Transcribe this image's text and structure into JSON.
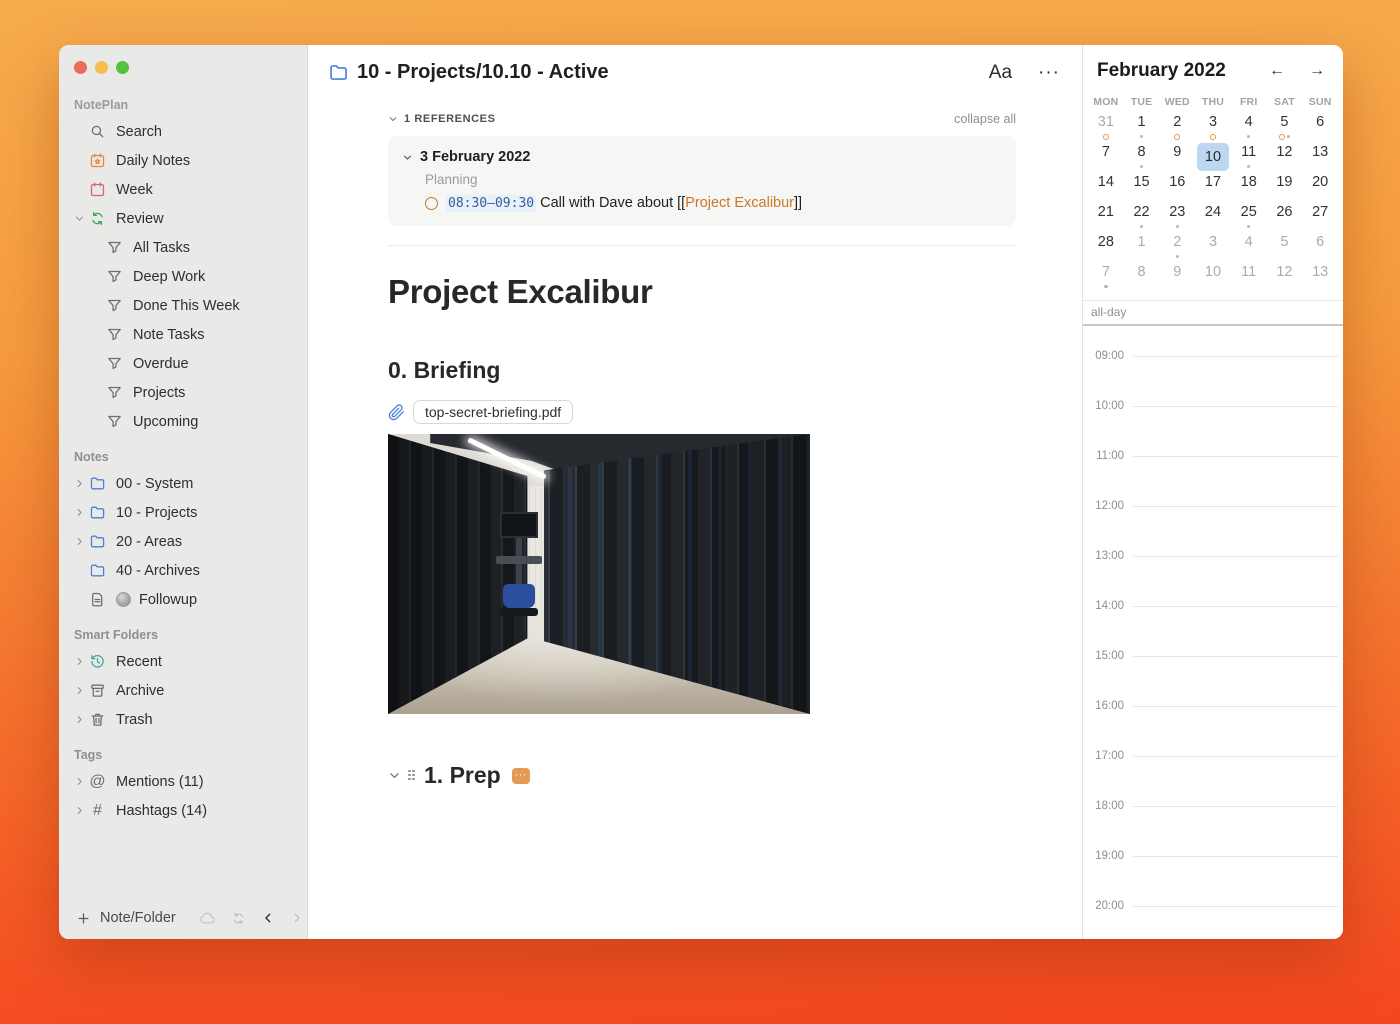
{
  "colors": {
    "background_top": "#F7AC4D",
    "background_bottom": "#F4461F",
    "accent_orange_link": "#CE7728",
    "timeblock_text": "#3A5C99",
    "timeblock_bg": "#E7F0FB",
    "selected_day_bg": "#BBD7F2",
    "event_ring": "#DFA13E",
    "task_dot": "#B9B9B9",
    "prep_badge_bg": "#E29A55"
  },
  "sidebar": {
    "app_name": "NotePlan",
    "top_items": [
      {
        "id": "search",
        "label": "Search",
        "icon": "search-icon",
        "color": "#6E6E6E",
        "chevron": "none"
      },
      {
        "id": "daily-notes",
        "label": "Daily Notes",
        "icon": "calendar-star-icon",
        "color": "#E8873A",
        "chevron": "none"
      },
      {
        "id": "week",
        "label": "Week",
        "icon": "calendar-icon",
        "color": "#E25C6A",
        "chevron": "none"
      },
      {
        "id": "review",
        "label": "Review",
        "icon": "sync-icon",
        "color": "#3BA55C",
        "chevron": "down"
      }
    ],
    "review_children": [
      {
        "id": "all-tasks",
        "label": "All Tasks",
        "icon": "filter-icon"
      },
      {
        "id": "deep-work",
        "label": "Deep Work",
        "icon": "filter-icon"
      },
      {
        "id": "done-this-week",
        "label": "Done This Week",
        "icon": "filter-icon"
      },
      {
        "id": "note-tasks",
        "label": "Note Tasks",
        "icon": "filter-icon"
      },
      {
        "id": "overdue",
        "label": "Overdue",
        "icon": "filter-icon"
      },
      {
        "id": "projects",
        "label": "Projects",
        "icon": "filter-icon"
      },
      {
        "id": "upcoming",
        "label": "Upcoming",
        "icon": "filter-icon"
      }
    ],
    "notes_section_label": "Notes",
    "folders": [
      {
        "id": "00-system",
        "label": "00 - System",
        "icon": "folder-icon",
        "color": "#4D7FD6",
        "chevron": "right"
      },
      {
        "id": "10-projects",
        "label": "10 - Projects",
        "icon": "folder-icon",
        "color": "#4D7FD6",
        "chevron": "right"
      },
      {
        "id": "20-areas",
        "label": "20 - Areas",
        "icon": "folder-icon",
        "color": "#4D7FD6",
        "chevron": "right"
      },
      {
        "id": "40-archives",
        "label": "40 - Archives",
        "icon": "folder-icon",
        "color": "#4D7FD6",
        "chevron": "none"
      },
      {
        "id": "followup",
        "label": "Followup",
        "icon": "document-icon",
        "color": "#6E6E6E",
        "chevron": "none",
        "emoji": true
      }
    ],
    "smart_folders_section_label": "Smart Folders",
    "smart_folders": [
      {
        "id": "recent",
        "label": "Recent",
        "icon": "history-icon",
        "color": "#3AA99F",
        "chevron": "right"
      },
      {
        "id": "archive",
        "label": "Archive",
        "icon": "archive-icon",
        "color": "#6E6E6E",
        "chevron": "right"
      },
      {
        "id": "trash",
        "label": "Trash",
        "icon": "trash-icon",
        "color": "#6E6E6E",
        "chevron": "right"
      }
    ],
    "tags_section_label": "Tags",
    "tags": [
      {
        "id": "mentions",
        "label": "Mentions (11)",
        "icon": "at-icon",
        "chevron": "right"
      },
      {
        "id": "hashtags",
        "label": "Hashtags (14)",
        "icon": "hash-icon",
        "chevron": "right"
      }
    ],
    "footer": {
      "new_note_label": "Note/Folder",
      "icons": [
        "plus-icon",
        "cloud-icon",
        "sync-icon",
        "chevron-left-icon",
        "chevron-right-icon"
      ]
    }
  },
  "editor": {
    "title": "10 - Projects/10.10 - Active",
    "title_icon": "folder-icon",
    "format_button_label": "Aa",
    "more_button_label": "···",
    "references": {
      "header": "1 REFERENCES",
      "collapse_all_label": "collapse all",
      "date": "3 February 2022",
      "context": "Planning",
      "time_range": "08:30–09:30",
      "task_text_before": " Call with Dave about [[",
      "task_link": "Project Excalibur",
      "task_text_after": "]]"
    },
    "heading1": "Project Excalibur",
    "heading2": "0. Briefing",
    "attachment_name": "top-secret-briefing.pdf",
    "attachment_icon": "paperclip-icon",
    "image_alt": "server-room-photo",
    "prep_heading": "1. Prep",
    "prep_badge": "···"
  },
  "calendar": {
    "month_title": "February 2022",
    "prev_arrow": "←",
    "next_arrow": "→",
    "weekdays": [
      "MON",
      "TUE",
      "WED",
      "THU",
      "FRI",
      "SAT",
      "SUN"
    ],
    "days": [
      {
        "n": "31",
        "muted": true,
        "marker": "ring"
      },
      {
        "n": "1",
        "marker": "dot"
      },
      {
        "n": "2",
        "marker": "ring"
      },
      {
        "n": "3",
        "marker": "ring"
      },
      {
        "n": "4",
        "marker": "dot"
      },
      {
        "n": "5",
        "marker": "ring+dot"
      },
      {
        "n": "6"
      },
      {
        "n": "7"
      },
      {
        "n": "8",
        "marker": "dot"
      },
      {
        "n": "9"
      },
      {
        "n": "10",
        "selected": true
      },
      {
        "n": "11",
        "marker": "dot"
      },
      {
        "n": "12"
      },
      {
        "n": "13"
      },
      {
        "n": "14"
      },
      {
        "n": "15"
      },
      {
        "n": "16"
      },
      {
        "n": "17"
      },
      {
        "n": "18"
      },
      {
        "n": "19"
      },
      {
        "n": "20"
      },
      {
        "n": "21"
      },
      {
        "n": "22",
        "marker": "dot"
      },
      {
        "n": "23",
        "marker": "dot"
      },
      {
        "n": "24"
      },
      {
        "n": "25",
        "marker": "dot"
      },
      {
        "n": "26"
      },
      {
        "n": "27"
      },
      {
        "n": "28"
      },
      {
        "n": "1",
        "muted": true
      },
      {
        "n": "2",
        "muted": true,
        "marker": "dot"
      },
      {
        "n": "3",
        "muted": true
      },
      {
        "n": "4",
        "muted": true
      },
      {
        "n": "5",
        "muted": true
      },
      {
        "n": "6",
        "muted": true
      },
      {
        "n": "7",
        "muted": true,
        "marker": "dot"
      },
      {
        "n": "8",
        "muted": true
      },
      {
        "n": "9",
        "muted": true
      },
      {
        "n": "10",
        "muted": true
      },
      {
        "n": "11",
        "muted": true
      },
      {
        "n": "12",
        "muted": true
      },
      {
        "n": "13",
        "muted": true
      }
    ],
    "all_day_label": "all-day",
    "times": [
      "09:00",
      "10:00",
      "11:00",
      "12:00",
      "13:00",
      "14:00",
      "15:00",
      "16:00",
      "17:00",
      "18:00",
      "19:00",
      "20:00"
    ]
  }
}
